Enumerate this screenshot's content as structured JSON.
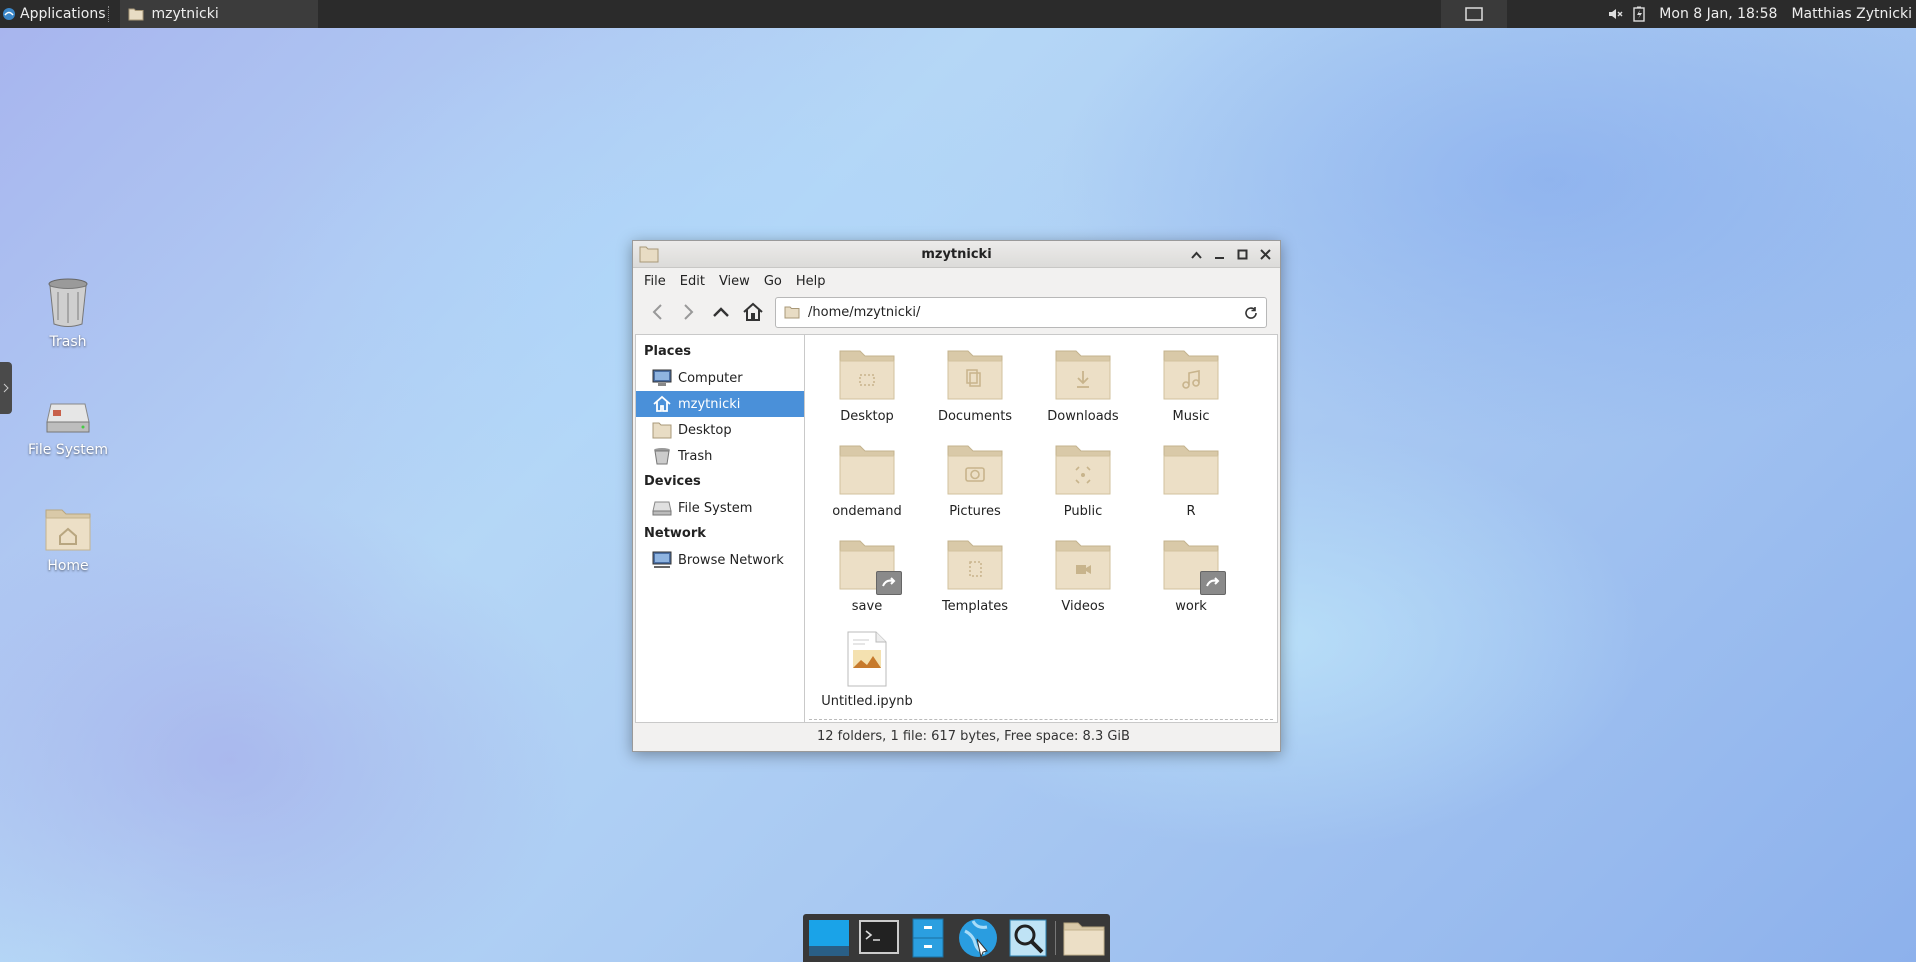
{
  "top_panel": {
    "applications_label": "Applications",
    "task_label": "mzytnicki",
    "clock": "Mon  8 Jan, 18:58",
    "user": "Matthias Zytnicki"
  },
  "desktop": {
    "icons": [
      {
        "label": "Trash"
      },
      {
        "label": "File System"
      },
      {
        "label": "Home"
      }
    ]
  },
  "window": {
    "title": "mzytnicki",
    "menu": [
      "File",
      "Edit",
      "View",
      "Go",
      "Help"
    ],
    "location": "/home/mzytnicki/",
    "sidebar": {
      "places_heading": "Places",
      "places": [
        "Computer",
        "mzytnicki",
        "Desktop",
        "Trash"
      ],
      "devices_heading": "Devices",
      "devices": [
        "File System"
      ],
      "network_heading": "Network",
      "network": [
        "Browse Network"
      ]
    },
    "items": [
      {
        "label": "Desktop",
        "emblem": "desktop-icon"
      },
      {
        "label": "Documents",
        "emblem": "documents-icon"
      },
      {
        "label": "Downloads",
        "emblem": "download-icon"
      },
      {
        "label": "Music",
        "emblem": "music-icon"
      },
      {
        "label": "ondemand",
        "emblem": "none"
      },
      {
        "label": "Pictures",
        "emblem": "camera-icon"
      },
      {
        "label": "Public",
        "emblem": "share-icon"
      },
      {
        "label": "R",
        "emblem": "none"
      },
      {
        "label": "save",
        "emblem": "symlink-icon"
      },
      {
        "label": "Templates",
        "emblem": "template-icon"
      },
      {
        "label": "Videos",
        "emblem": "video-icon"
      },
      {
        "label": "work",
        "emblem": "symlink-icon"
      },
      {
        "label": "Untitled.ipynb",
        "emblem": "file-icon"
      }
    ],
    "status": "12 folders, 1 file: 617 bytes, Free space: 8.3 GiB",
    "colors": {
      "selection": "#4a90d9",
      "folder": "#e8dcc4"
    }
  }
}
